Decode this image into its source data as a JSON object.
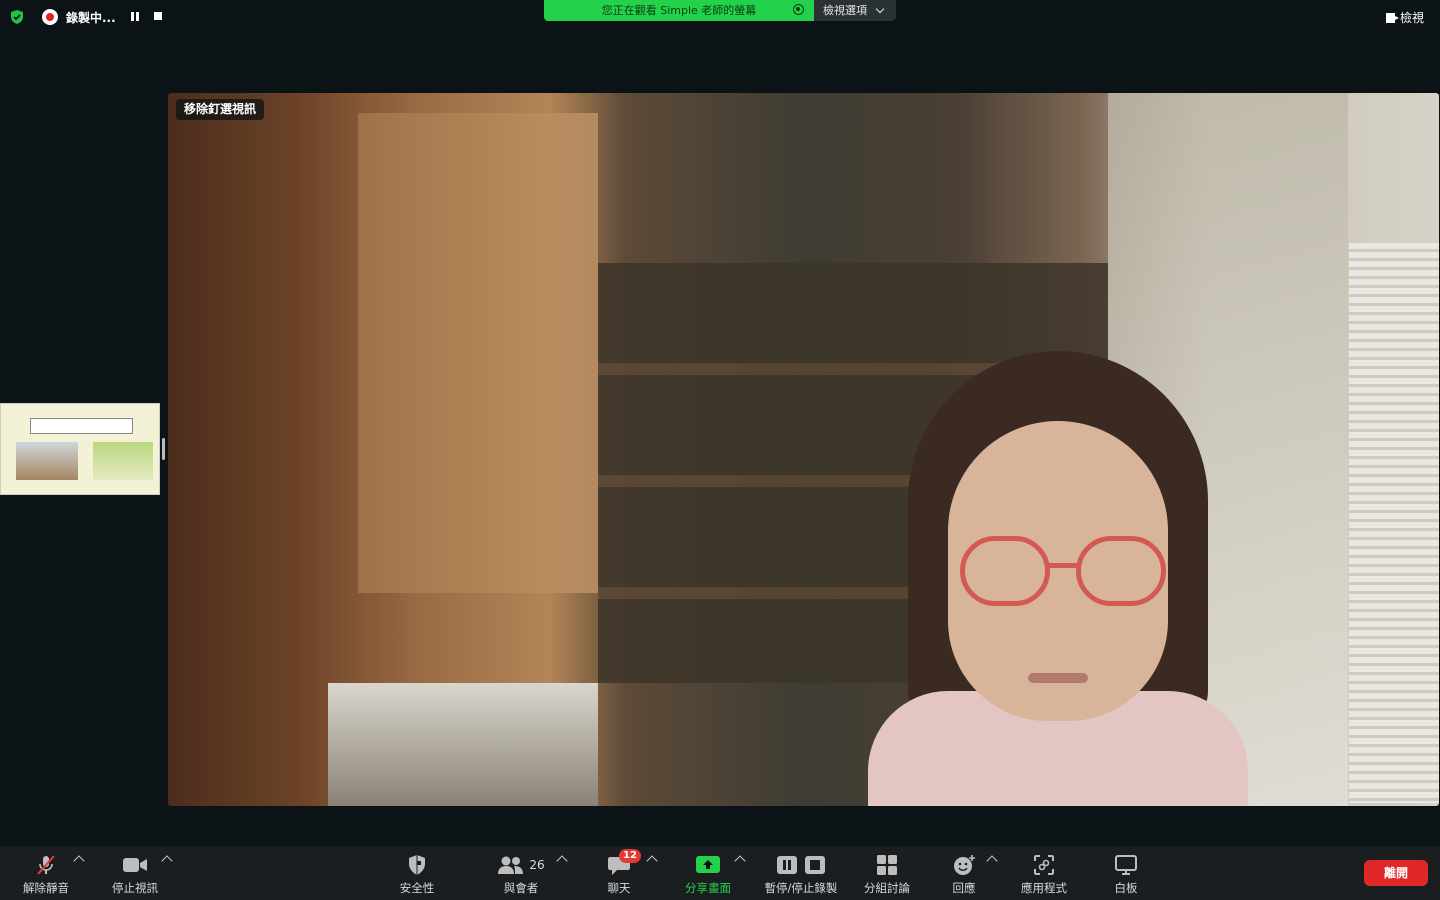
{
  "topbar": {
    "recording_label": "錄製中...",
    "share_banner": "您正在觀看 Simple 老師的螢幕",
    "view_options": "檢視選項",
    "view_button": "檢視"
  },
  "video": {
    "unpin_label": "移除釘選視訊"
  },
  "toolbar": {
    "unmute": "解除靜音",
    "stop_video": "停止視訊",
    "security": "安全性",
    "participants": "與會者",
    "participants_count": "26",
    "chat": "聊天",
    "chat_badge": "12",
    "share_screen": "分享畫面",
    "pause_stop_recording": "暫停/停止錄製",
    "breakout": "分組討論",
    "reactions": "回應",
    "apps": "應用程式",
    "whiteboard": "白板",
    "leave": "離開"
  },
  "colors": {
    "share_green": "#23d24a",
    "leave_red": "#e02828",
    "badge_red": "#e53935"
  }
}
